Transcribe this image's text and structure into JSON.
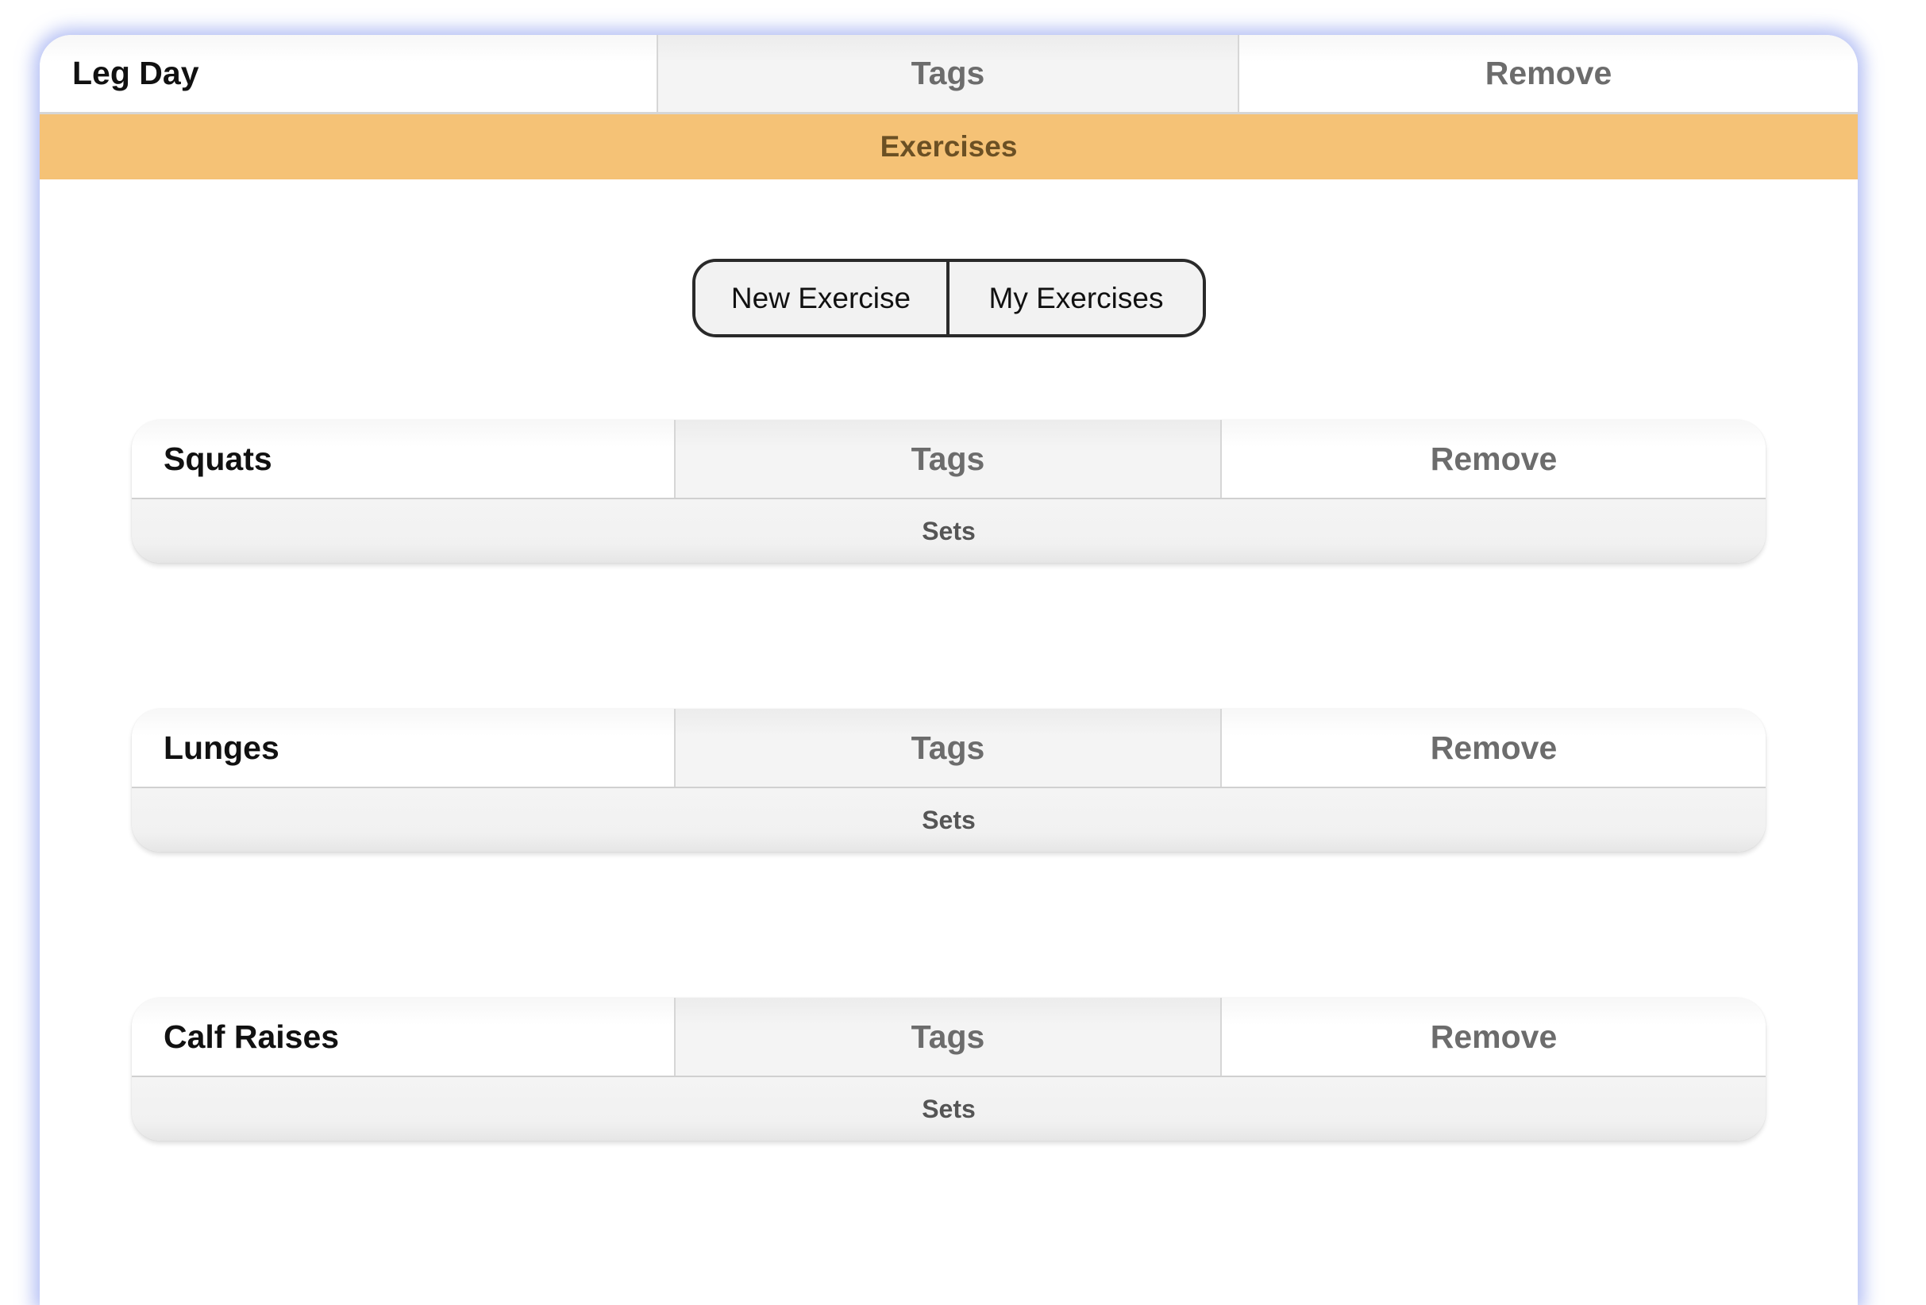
{
  "workout": {
    "name": "Leg Day",
    "tags_label": "Tags",
    "remove_label": "Remove",
    "section_label": "Exercises"
  },
  "exercise_toggle": {
    "new_label": "New Exercise",
    "mine_label": "My Exercises"
  },
  "exercises": [
    {
      "name": "Squats",
      "tags_label": "Tags",
      "remove_label": "Remove",
      "sets_label": "Sets"
    },
    {
      "name": "Lunges",
      "tags_label": "Tags",
      "remove_label": "Remove",
      "sets_label": "Sets"
    },
    {
      "name": "Calf Raises",
      "tags_label": "Tags",
      "remove_label": "Remove",
      "sets_label": "Sets"
    }
  ],
  "colors": {
    "accent_banner": "#f5c276",
    "banner_text": "#6b5024",
    "card_glow": "#788cec"
  }
}
